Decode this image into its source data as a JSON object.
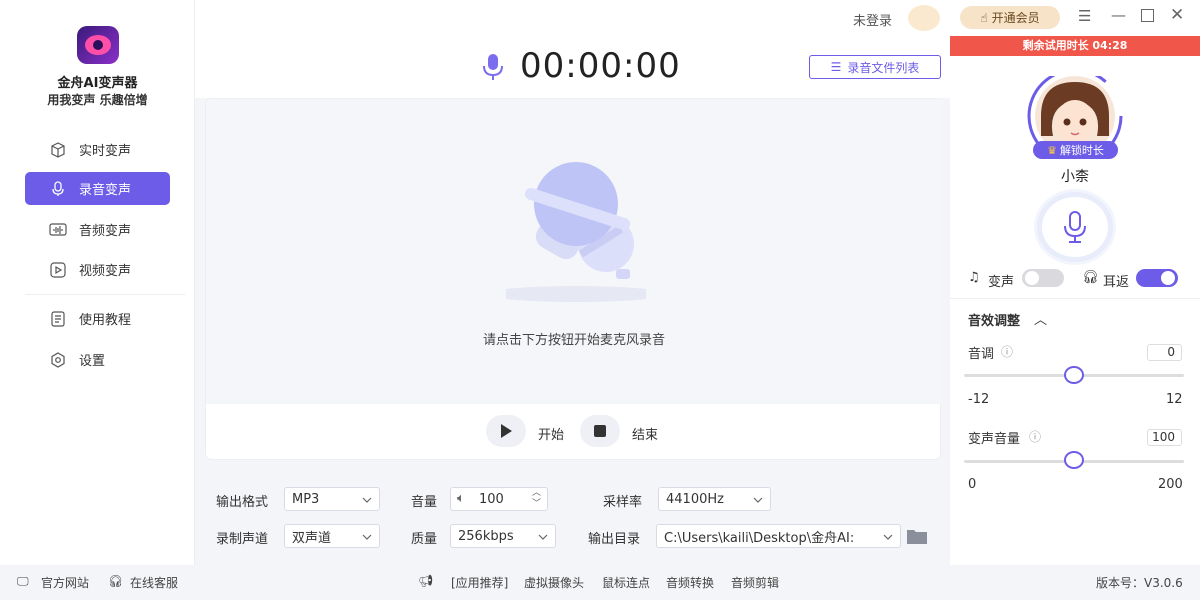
{
  "app": {
    "title": "金舟AI变声器",
    "subtitle": "用我变声 乐趣倍增"
  },
  "sidebar": {
    "items": [
      {
        "label": "实时变声",
        "icon": "cube-icon"
      },
      {
        "label": "录音变声",
        "icon": "microphone-icon",
        "active": true
      },
      {
        "label": "音频变声",
        "icon": "audio-wave-icon"
      },
      {
        "label": "视频变声",
        "icon": "video-play-icon"
      },
      {
        "label": "使用教程",
        "icon": "book-icon"
      },
      {
        "label": "设置",
        "icon": "gear-icon"
      }
    ]
  },
  "header": {
    "login_status": "未登录",
    "vip_button": "开通会员"
  },
  "recorder": {
    "timer": "00:00:00",
    "file_list_button": "录音文件列表",
    "hint": "请点击下方按钮开始麦克风录音",
    "start_label": "开始",
    "stop_label": "结束"
  },
  "settings": {
    "output_format_label": "输出格式",
    "output_format_value": "MP3",
    "volume_label": "音量",
    "volume_value": "100",
    "sample_rate_label": "采样率",
    "sample_rate_value": "44100Hz",
    "channel_label": "录制声道",
    "channel_value": "双声道",
    "quality_label": "质量",
    "quality_value": "256kbps",
    "output_dir_label": "输出目录",
    "output_dir_value": "C:\\Users\\kaili\\Desktop\\金舟AI:"
  },
  "right": {
    "trial_text": "剩余试用时长 04:28",
    "unlock_label": "解锁时长",
    "voice_name": "小柰",
    "voice_change_label": "变声",
    "voice_change_on": false,
    "ear_return_label": "耳返",
    "ear_return_on": true,
    "effects_title": "音效调整",
    "pitch_label": "音调",
    "pitch_value": "0",
    "pitch_min": "-12",
    "pitch_max": "12",
    "pitch_level": 0.5,
    "vol_label": "变声音量",
    "vol_value": "100",
    "vol_min": "0",
    "vol_max": "200",
    "vol_level": 0.5
  },
  "footer": {
    "website": "官方网站",
    "service": "在线客服",
    "recommend": "[应用推荐]",
    "links": [
      "虚拟摄像头",
      "鼠标连点",
      "音频转换",
      "音频剪辑"
    ],
    "version": "版本号：V3.0.6"
  },
  "colors": {
    "accent": "#6c5ce7",
    "trial": "#f0564a",
    "vip": "#f6e3c8"
  }
}
